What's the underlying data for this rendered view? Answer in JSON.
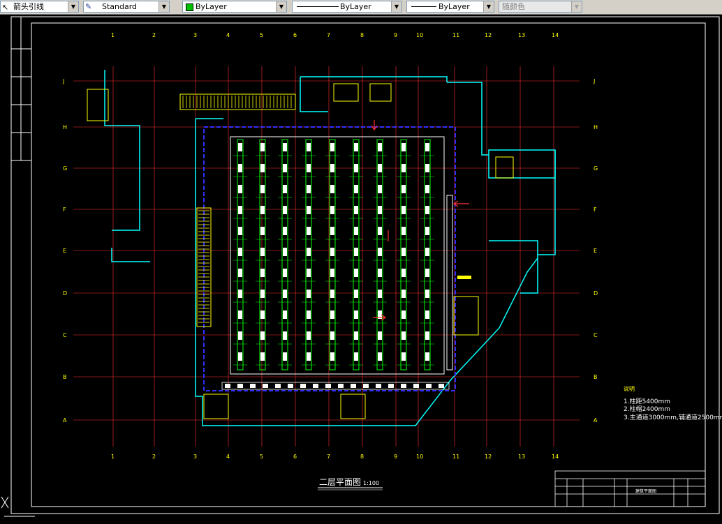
{
  "toolbar": {
    "multileader_style": "箭头引线",
    "text_style": "Standard",
    "color": "ByLayer",
    "linetype": "ByLayer",
    "lineweight": "ByLayer",
    "plot_style": "随颜色",
    "color_swatch": "#00c000"
  },
  "drawing": {
    "title": "二层平面图",
    "scale": "1:100",
    "notes": [
      "1.柱距5400mm",
      "2.柱帽2400mm",
      "3.主通道3000mm,辅通道2500mm"
    ],
    "grid_cols": [
      "1",
      "2",
      "3",
      "4",
      "5",
      "6",
      "7",
      "8",
      "9",
      "10",
      "11",
      "12",
      "13",
      "14"
    ],
    "grid_rows": [
      "J",
      "H",
      "G",
      "F",
      "E",
      "D",
      "C",
      "B",
      "A"
    ],
    "title_block": [
      "建筑平面图"
    ]
  },
  "colors": {
    "background": "#000000",
    "grid_red": "#ff3030",
    "dim_yellow": "#ffff00",
    "wall_cyan": "#00ffff",
    "shelf_green": "#00ff00",
    "frame_white": "#ffffff",
    "partition_blue": "#3030ff"
  }
}
